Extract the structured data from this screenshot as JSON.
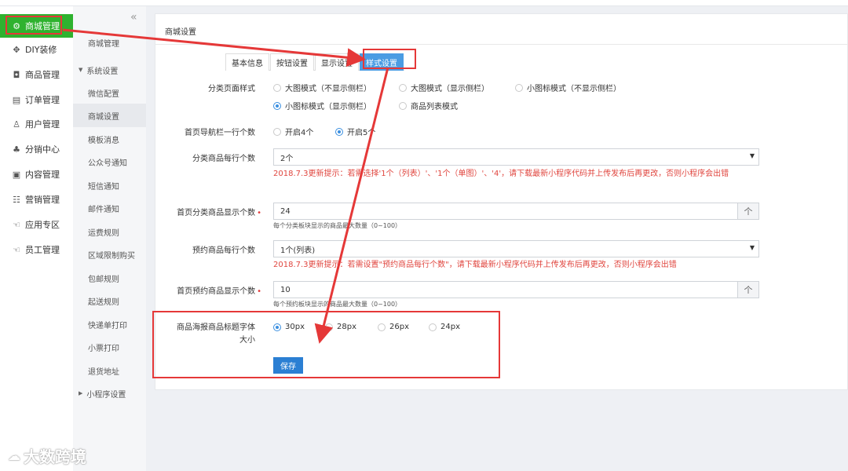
{
  "sidebar": {
    "items": [
      {
        "icon": "gear-icon",
        "glyph": "⚙",
        "label": "商城管理",
        "active": true
      },
      {
        "icon": "diy-icon",
        "glyph": "✥",
        "label": "DIY装修"
      },
      {
        "icon": "bag-icon",
        "glyph": "◘",
        "label": "商品管理"
      },
      {
        "icon": "order-icon",
        "glyph": "▤",
        "label": "订单管理"
      },
      {
        "icon": "user-icon",
        "glyph": "♙",
        "label": "用户管理"
      },
      {
        "icon": "distribution-icon",
        "glyph": "♣",
        "label": "分销中心"
      },
      {
        "icon": "content-icon",
        "glyph": "▣",
        "label": "内容管理"
      },
      {
        "icon": "marketing-icon",
        "glyph": "☷",
        "label": "营销管理"
      },
      {
        "icon": "app-icon",
        "glyph": "☜",
        "label": "应用专区"
      },
      {
        "icon": "staff-icon",
        "glyph": "☜",
        "label": "员工管理"
      }
    ]
  },
  "subsidebar": {
    "collapse_glyph": "«",
    "items": [
      {
        "label": "商城管理"
      },
      {
        "label": "系统设置",
        "group": true,
        "expanded": true
      },
      {
        "label": "微信配置"
      },
      {
        "label": "商城设置",
        "active": true
      },
      {
        "label": "模板消息"
      },
      {
        "label": "公众号通知"
      },
      {
        "label": "短信通知"
      },
      {
        "label": "邮件通知"
      },
      {
        "label": "运费规则"
      },
      {
        "label": "区域限制购买"
      },
      {
        "label": "包邮规则"
      },
      {
        "label": "起送规则"
      },
      {
        "label": "快递单打印"
      },
      {
        "label": "小票打印"
      },
      {
        "label": "退货地址"
      },
      {
        "label": "小程序设置",
        "group": true,
        "expanded": false
      }
    ]
  },
  "page": {
    "title": "商城设置",
    "tabs": [
      {
        "label": "基本信息"
      },
      {
        "label": "按钮设置"
      },
      {
        "label": "显示设置"
      },
      {
        "label": "样式设置",
        "active": true
      }
    ]
  },
  "form": {
    "category_style": {
      "label": "分类页面样式",
      "options": [
        "大图模式（不显示侧栏）",
        "大图模式（显示侧栏）",
        "小图标模式（不显示侧栏）",
        "小图标模式（显示侧栏）",
        "商品列表模式"
      ],
      "selected": 3
    },
    "nav_per_row": {
      "label": "首页导航栏一行个数",
      "options": [
        "开启4个",
        "开启5个"
      ],
      "selected": 1
    },
    "category_goods_per_row": {
      "label": "分类商品每行个数",
      "value": "2个",
      "hint": "2018.7.3更新提示：若需选择'1个（列表）'、'1个（单图）'、'4'，请下载最新小程序代码并上传发布后再更改，否则小程序会出错"
    },
    "home_category_count": {
      "label": "首页分类商品显示个数",
      "required": "•",
      "value": "24",
      "hint": "每个分类板块显示的商品最大数量（0~100）",
      "stepper": "个"
    },
    "booking_per_row": {
      "label": "预约商品每行个数",
      "value": "1个(列表)",
      "hint": "2018.7.3更新提示：若需设置\"预约商品每行个数\"，请下载最新小程序代码并上传发布后再更改，否则小程序会出错"
    },
    "home_booking_count": {
      "label": "首页预约商品显示个数",
      "required": "•",
      "value": "10",
      "hint": "每个预约板块显示的商品最大数量（0~100）",
      "stepper": "个"
    },
    "poster_font": {
      "label_line1": "商品海报商品标题字体",
      "label_line2": "大小",
      "options": [
        "30px",
        "28px",
        "26px",
        "24px"
      ],
      "selected": 0
    },
    "save_label": "保存",
    "select_arrow": "▼"
  },
  "watermark": {
    "icon": "wechat-logo-icon",
    "text": "大数跨境"
  },
  "colors": {
    "accent": "#2fb22f",
    "primary": "#2b7fd3",
    "tab_active": "#4a9ce3",
    "annotation": "#e53838"
  }
}
